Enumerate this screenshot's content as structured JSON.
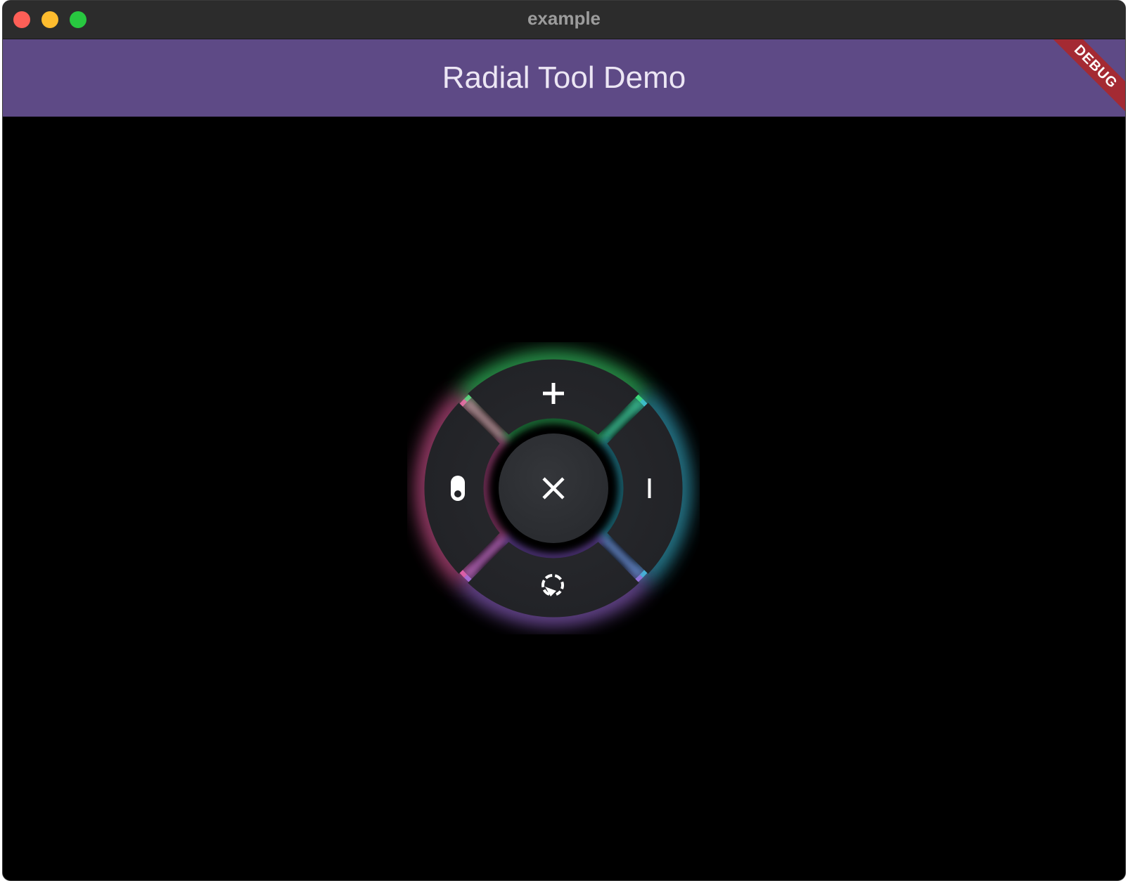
{
  "window": {
    "title": "example"
  },
  "appbar": {
    "title": "Radial Tool Demo",
    "color": "#5e4a86"
  },
  "debug_banner": {
    "label": "DEBUG",
    "color": "#a42a33"
  },
  "radial_menu": {
    "items": [
      {
        "position": "top",
        "icon": "plus-icon",
        "glow_color": "#3ddc6f"
      },
      {
        "position": "right",
        "icon": "text-cursor-icon",
        "glow_color": "#3bb8d6"
      },
      {
        "position": "bottom",
        "icon": "rotate-dashed-icon",
        "glow_color": "#9b6ad8"
      },
      {
        "position": "left",
        "icon": "toggle-icon",
        "glow_color": "#e45a9c"
      }
    ],
    "center": {
      "icon": "close-icon"
    },
    "segment_color": "#232428"
  }
}
